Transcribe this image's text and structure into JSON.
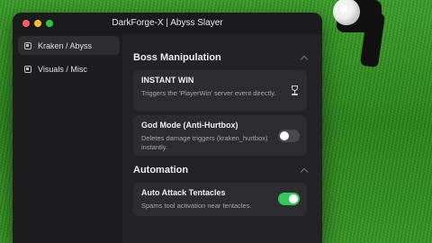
{
  "window": {
    "title": "DarkForge-X | Abyss Slayer"
  },
  "sidebar": {
    "items": [
      {
        "label": "Kraken / Abyss",
        "active": true
      },
      {
        "label": "Visuals / Misc",
        "active": false
      }
    ]
  },
  "sections": [
    {
      "title": "Boss Manipulation",
      "cards": [
        {
          "title": "INSTANT WIN",
          "desc": "Triggers the 'PlayerWin' server event directly.",
          "control": "trophy-icon"
        },
        {
          "title": "God Mode (Anti-Hurtbox)",
          "desc": "Deletes damage triggers (kraken_hurtbox) instantly.",
          "control": "toggle",
          "enabled": false
        }
      ]
    },
    {
      "title": "Automation",
      "cards": [
        {
          "title": "Auto Attack Tentacles",
          "desc": "Spams tool activation near tentacles.",
          "control": "toggle",
          "enabled": true
        }
      ]
    }
  ],
  "colors": {
    "toggle_on": "#34c85a",
    "toggle_off": "#4a4a4e",
    "grass": "#3a9a27"
  }
}
